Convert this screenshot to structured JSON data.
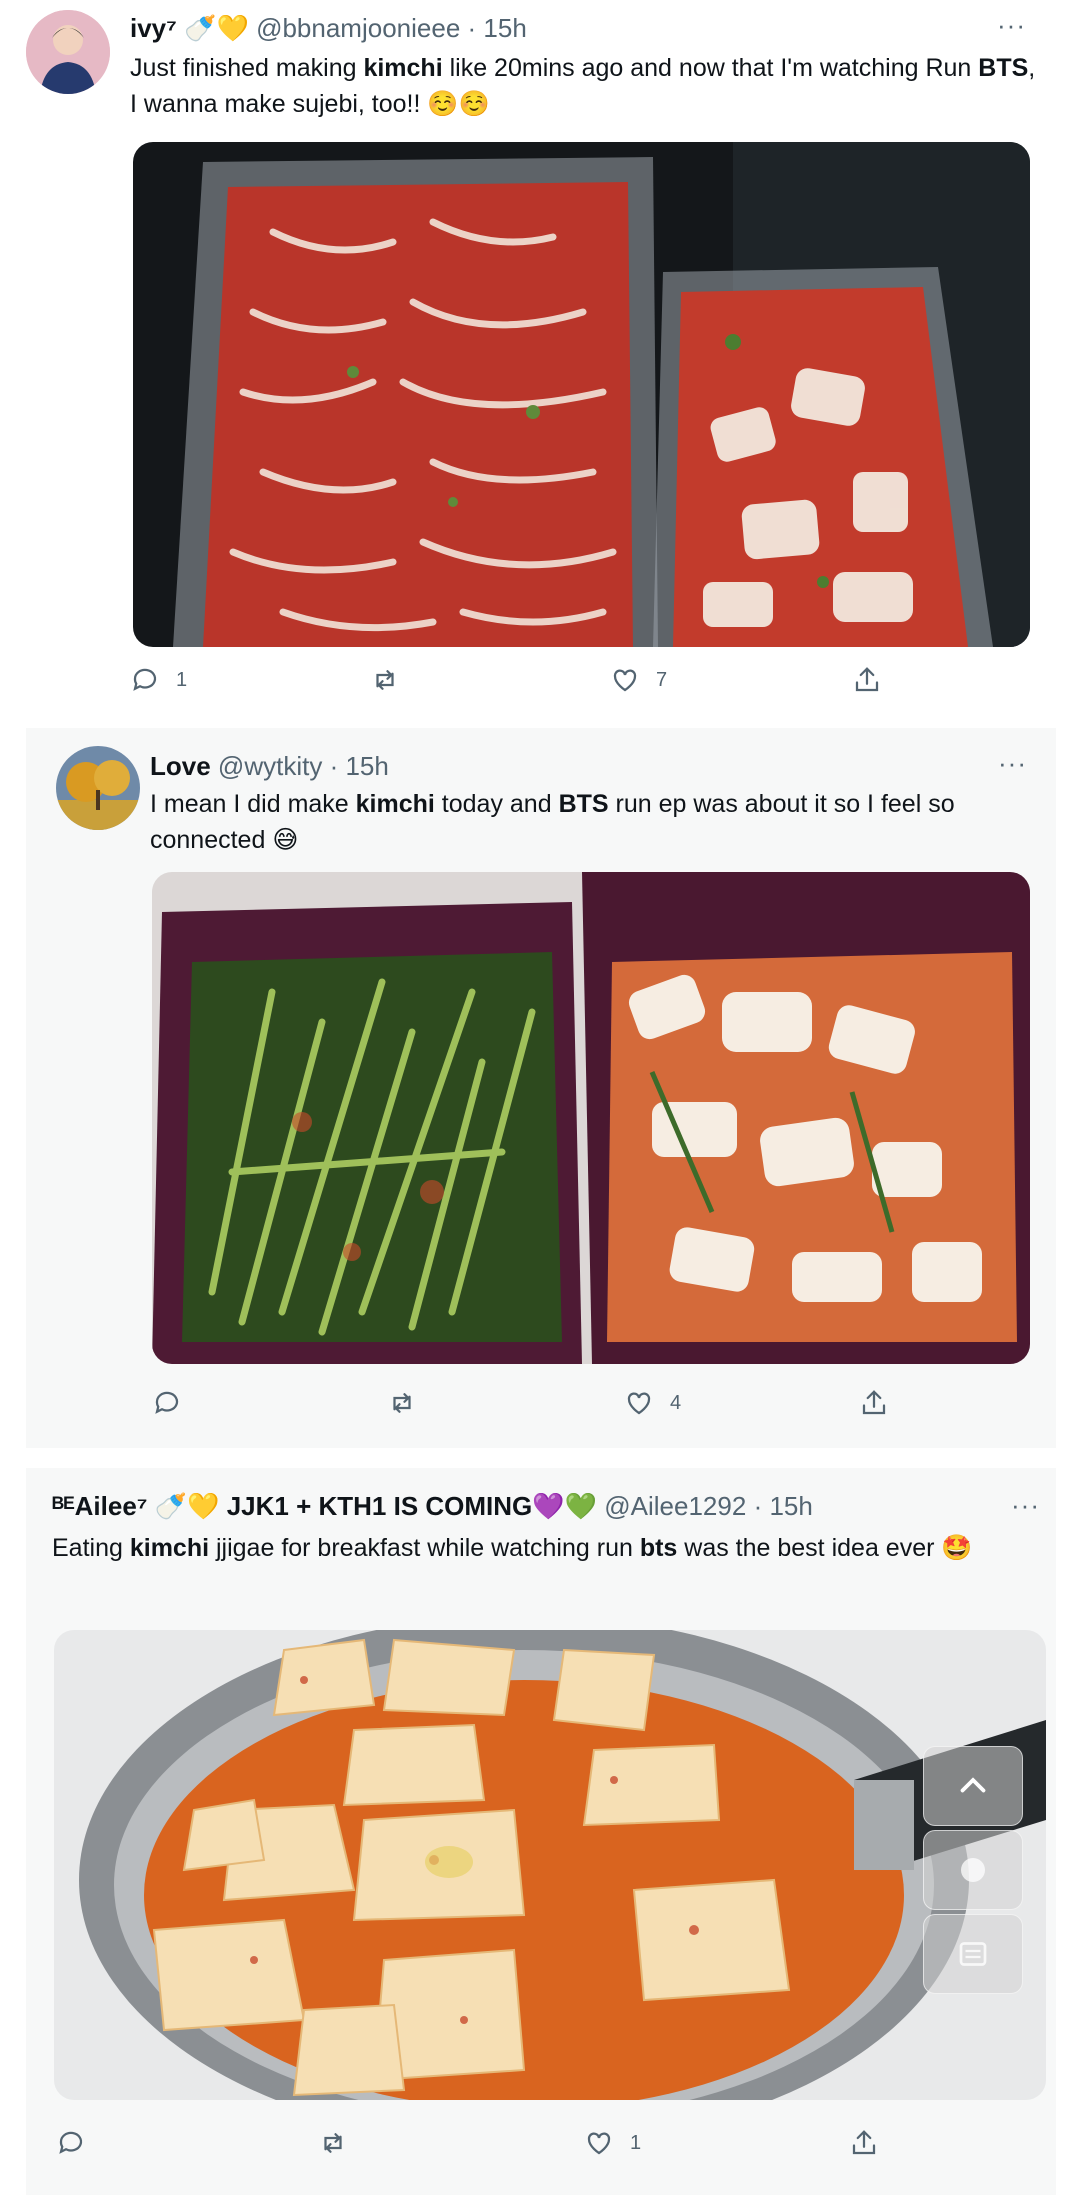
{
  "tweets": [
    {
      "name": "ivy⁷ 🍼💛",
      "handle": "@bbnamjoonieee",
      "time": "· 15h",
      "more": "···",
      "text_parts": [
        "Just finished making ",
        "kimchi",
        " like 20mins ago and now that I'm watching Run ",
        "BTS",
        ", I wanna make sujebi, too!! ☺️☺️"
      ],
      "reply_count": "1",
      "retweet_count": "",
      "like_count": "7"
    },
    {
      "name": "Love",
      "handle": "@wytkity",
      "time": "· 15h",
      "more": "···",
      "text_parts": [
        "I mean I did make ",
        "kimchi",
        " today and ",
        "BTS",
        " run ep was about it so I feel so connected 😅"
      ],
      "reply_count": "",
      "retweet_count": "",
      "like_count": "4"
    },
    {
      "name": "ᴮᴱAilee⁷ 🍼💛 JJK1 + KTH1 IS COMING💜💚",
      "handle": "@Ailee1292",
      "time": "· 15h",
      "more": "···",
      "text_parts": [
        "Eating ",
        "kimchi",
        " jjigae for breakfast while watching run ",
        "bts",
        " was the best idea ever 🤩"
      ],
      "reply_count": "",
      "retweet_count": "",
      "like_count": "1"
    }
  ],
  "icons": {
    "reply": "reply-icon",
    "retweet": "retweet-icon",
    "like": "heart-icon",
    "share": "share-icon",
    "scroll_top": "chevron-up-icon",
    "compose": "compose-icon",
    "messages": "messages-icon"
  },
  "colors": {
    "text": "#0f1419",
    "muted": "#536471",
    "kimchi_red": "#c8402a",
    "container_purple": "#5a1f3a",
    "tofu": "#f4e4c8"
  }
}
